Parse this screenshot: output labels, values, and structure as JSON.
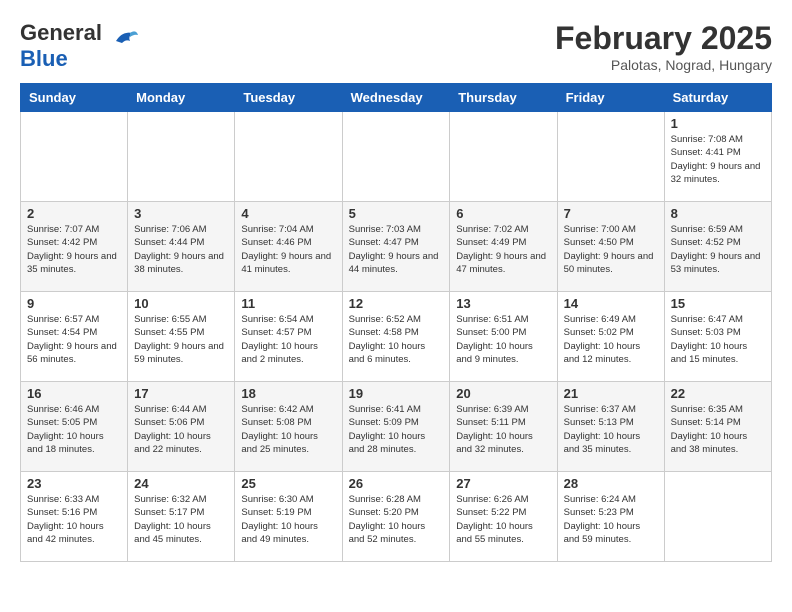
{
  "header": {
    "logo_general": "General",
    "logo_blue": "Blue",
    "month": "February 2025",
    "location": "Palotas, Nograd, Hungary"
  },
  "days_of_week": [
    "Sunday",
    "Monday",
    "Tuesday",
    "Wednesday",
    "Thursday",
    "Friday",
    "Saturday"
  ],
  "weeks": [
    [
      {
        "day": "",
        "info": ""
      },
      {
        "day": "",
        "info": ""
      },
      {
        "day": "",
        "info": ""
      },
      {
        "day": "",
        "info": ""
      },
      {
        "day": "",
        "info": ""
      },
      {
        "day": "",
        "info": ""
      },
      {
        "day": "1",
        "info": "Sunrise: 7:08 AM\nSunset: 4:41 PM\nDaylight: 9 hours and 32 minutes."
      }
    ],
    [
      {
        "day": "2",
        "info": "Sunrise: 7:07 AM\nSunset: 4:42 PM\nDaylight: 9 hours and 35 minutes."
      },
      {
        "day": "3",
        "info": "Sunrise: 7:06 AM\nSunset: 4:44 PM\nDaylight: 9 hours and 38 minutes."
      },
      {
        "day": "4",
        "info": "Sunrise: 7:04 AM\nSunset: 4:46 PM\nDaylight: 9 hours and 41 minutes."
      },
      {
        "day": "5",
        "info": "Sunrise: 7:03 AM\nSunset: 4:47 PM\nDaylight: 9 hours and 44 minutes."
      },
      {
        "day": "6",
        "info": "Sunrise: 7:02 AM\nSunset: 4:49 PM\nDaylight: 9 hours and 47 minutes."
      },
      {
        "day": "7",
        "info": "Sunrise: 7:00 AM\nSunset: 4:50 PM\nDaylight: 9 hours and 50 minutes."
      },
      {
        "day": "8",
        "info": "Sunrise: 6:59 AM\nSunset: 4:52 PM\nDaylight: 9 hours and 53 minutes."
      }
    ],
    [
      {
        "day": "9",
        "info": "Sunrise: 6:57 AM\nSunset: 4:54 PM\nDaylight: 9 hours and 56 minutes."
      },
      {
        "day": "10",
        "info": "Sunrise: 6:55 AM\nSunset: 4:55 PM\nDaylight: 9 hours and 59 minutes."
      },
      {
        "day": "11",
        "info": "Sunrise: 6:54 AM\nSunset: 4:57 PM\nDaylight: 10 hours and 2 minutes."
      },
      {
        "day": "12",
        "info": "Sunrise: 6:52 AM\nSunset: 4:58 PM\nDaylight: 10 hours and 6 minutes."
      },
      {
        "day": "13",
        "info": "Sunrise: 6:51 AM\nSunset: 5:00 PM\nDaylight: 10 hours and 9 minutes."
      },
      {
        "day": "14",
        "info": "Sunrise: 6:49 AM\nSunset: 5:02 PM\nDaylight: 10 hours and 12 minutes."
      },
      {
        "day": "15",
        "info": "Sunrise: 6:47 AM\nSunset: 5:03 PM\nDaylight: 10 hours and 15 minutes."
      }
    ],
    [
      {
        "day": "16",
        "info": "Sunrise: 6:46 AM\nSunset: 5:05 PM\nDaylight: 10 hours and 18 minutes."
      },
      {
        "day": "17",
        "info": "Sunrise: 6:44 AM\nSunset: 5:06 PM\nDaylight: 10 hours and 22 minutes."
      },
      {
        "day": "18",
        "info": "Sunrise: 6:42 AM\nSunset: 5:08 PM\nDaylight: 10 hours and 25 minutes."
      },
      {
        "day": "19",
        "info": "Sunrise: 6:41 AM\nSunset: 5:09 PM\nDaylight: 10 hours and 28 minutes."
      },
      {
        "day": "20",
        "info": "Sunrise: 6:39 AM\nSunset: 5:11 PM\nDaylight: 10 hours and 32 minutes."
      },
      {
        "day": "21",
        "info": "Sunrise: 6:37 AM\nSunset: 5:13 PM\nDaylight: 10 hours and 35 minutes."
      },
      {
        "day": "22",
        "info": "Sunrise: 6:35 AM\nSunset: 5:14 PM\nDaylight: 10 hours and 38 minutes."
      }
    ],
    [
      {
        "day": "23",
        "info": "Sunrise: 6:33 AM\nSunset: 5:16 PM\nDaylight: 10 hours and 42 minutes."
      },
      {
        "day": "24",
        "info": "Sunrise: 6:32 AM\nSunset: 5:17 PM\nDaylight: 10 hours and 45 minutes."
      },
      {
        "day": "25",
        "info": "Sunrise: 6:30 AM\nSunset: 5:19 PM\nDaylight: 10 hours and 49 minutes."
      },
      {
        "day": "26",
        "info": "Sunrise: 6:28 AM\nSunset: 5:20 PM\nDaylight: 10 hours and 52 minutes."
      },
      {
        "day": "27",
        "info": "Sunrise: 6:26 AM\nSunset: 5:22 PM\nDaylight: 10 hours and 55 minutes."
      },
      {
        "day": "28",
        "info": "Sunrise: 6:24 AM\nSunset: 5:23 PM\nDaylight: 10 hours and 59 minutes."
      },
      {
        "day": "",
        "info": ""
      }
    ]
  ]
}
